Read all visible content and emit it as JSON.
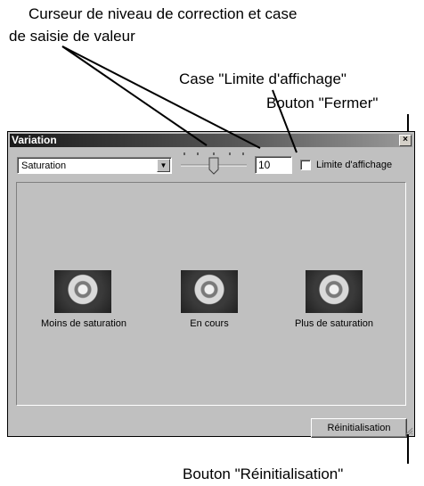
{
  "callouts": {
    "slider_line1": "Curseur de niveau de correction et case",
    "slider_line2": "de saisie de valeur",
    "limit": "Case \"Limite d'affichage\"",
    "close": "Bouton \"Fermer\"",
    "reset": "Bouton \"Réinitialisation\""
  },
  "window": {
    "title": "Variation",
    "close_glyph": "×"
  },
  "controls": {
    "mode_select": "Saturation",
    "value": "10",
    "limit_label": "Limite d'affichage",
    "limit_checked": false,
    "slider_position": 0.5
  },
  "previews": [
    {
      "label": "Moins de saturation"
    },
    {
      "label": "En cours"
    },
    {
      "label": "Plus de saturation"
    }
  ],
  "buttons": {
    "reset": "Réinitialisation"
  }
}
